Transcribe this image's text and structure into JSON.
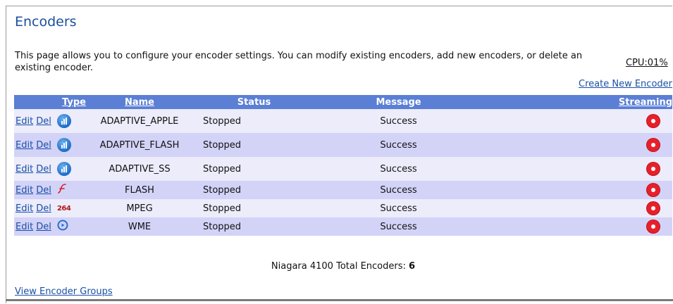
{
  "page": {
    "title": "Encoders",
    "description": "This page allows you to configure your encoder settings. You can modify existing encoders, add new encoders, or delete an existing encoder.",
    "cpu": "CPU:01%",
    "create_link": "Create New Encoder",
    "groups_link": "View Encoder Groups"
  },
  "table": {
    "headers": {
      "type": "Type",
      "name": "Name",
      "status": "Status",
      "message": "Message",
      "streaming": "Streaming"
    },
    "actions": {
      "edit": "Edit",
      "del": "Del"
    },
    "rows": [
      {
        "icon": "adaptive-icon",
        "name": "ADAPTIVE_APPLE",
        "status": "Stopped",
        "message": "Success",
        "streaming": "stopped"
      },
      {
        "icon": "adaptive-icon",
        "name": "ADAPTIVE_FLASH",
        "status": "Stopped",
        "message": "Success",
        "streaming": "stopped"
      },
      {
        "icon": "adaptive-icon",
        "name": "ADAPTIVE_SS",
        "status": "Stopped",
        "message": "Success",
        "streaming": "stopped"
      },
      {
        "icon": "flash-icon",
        "name": "FLASH",
        "status": "Stopped",
        "message": "Success",
        "streaming": "stopped"
      },
      {
        "icon": "h264-icon",
        "icon_text": "264",
        "name": "MPEG",
        "status": "Stopped",
        "message": "Success",
        "streaming": "stopped"
      },
      {
        "icon": "wme-icon",
        "name": "WME",
        "status": "Stopped",
        "message": "Success",
        "streaming": "stopped"
      }
    ]
  },
  "footer": {
    "total_label": "Niagara 4100 Total Encoders:",
    "total_count": "6"
  },
  "colors": {
    "header_bg": "#5a7fd4",
    "row_odd": "#ececfb",
    "row_even": "#d3d3f8",
    "title": "#1b4f9c",
    "link": "#1a4fa6",
    "stop_red": "#e8202a"
  }
}
